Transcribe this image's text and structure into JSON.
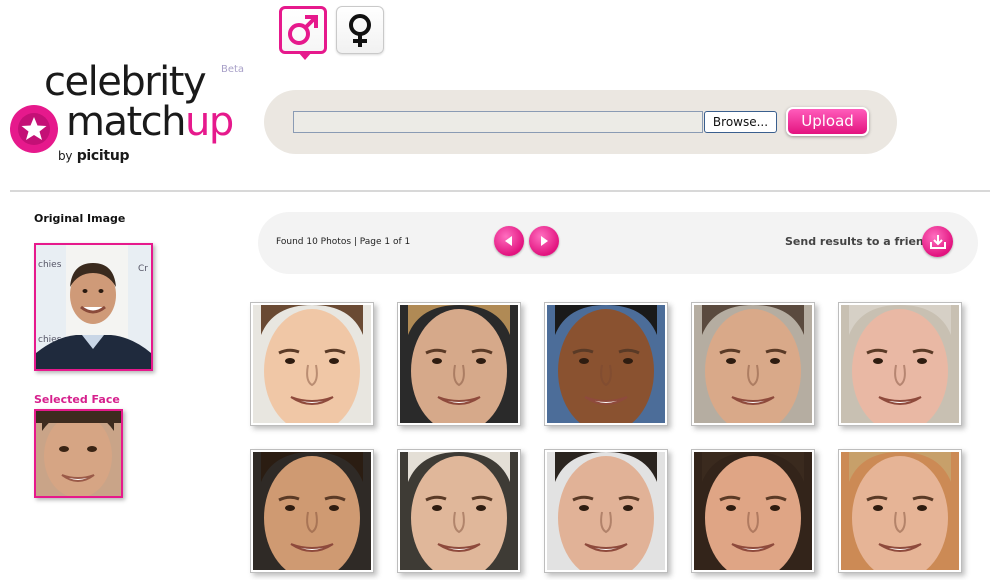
{
  "header": {
    "gender_selector": [
      {
        "id": "male",
        "icon": "male-symbol-icon",
        "selected": true
      },
      {
        "id": "female",
        "icon": "female-symbol-icon",
        "selected": false
      }
    ]
  },
  "logo": {
    "line1": "celebrity",
    "line2_part1": "match",
    "line2_part2": "up",
    "by_prefix": "by",
    "byline": "picitup",
    "badge": "Beta",
    "icon": "star-icon"
  },
  "upload": {
    "browse_label": "Browse...",
    "upload_label": "Upload"
  },
  "left_panel": {
    "original_label": "Original Image",
    "selected_label": "Selected Face"
  },
  "results": {
    "summary": "Found 10 Photos | Page 1 of 1",
    "send_label": "Send results to a friend",
    "prev_icon": "arrow-left-icon",
    "next_icon": "arrow-right-icon",
    "send_icon": "inbox-download-icon"
  },
  "colors": {
    "accent": "#e6198c",
    "bar_background": "#ebe7e1",
    "results_bar": "#f3f3f3",
    "selected_label": "#d6208d"
  },
  "photos": [
    {
      "skin": "#f0c7a6",
      "bg": "#e8e6e0",
      "hair": "#6a4a33"
    },
    {
      "skin": "#d6a98a",
      "bg": "#2a2a2a",
      "hair": "#b08a55"
    },
    {
      "skin": "#8a5230",
      "bg": "#4c6d99",
      "hair": "#1a1a1a"
    },
    {
      "skin": "#d9a989",
      "bg": "#b5ada1",
      "hair": "#5a4a3e"
    },
    {
      "skin": "#e9b8a4",
      "bg": "#c8c0b2",
      "hair": "#d6d0c6"
    },
    {
      "skin": "#cf9a72",
      "bg": "#2f2a26",
      "hair": "#2b1d12"
    },
    {
      "skin": "#e0b79a",
      "bg": "#3e3b35",
      "hair": "#e4dfd6"
    },
    {
      "skin": "#e1b297",
      "bg": "#e2e2e2",
      "hair": "#2a241f"
    },
    {
      "skin": "#dfa585",
      "bg": "#33241a",
      "hair": "#3a2a1e"
    },
    {
      "skin": "#e6b496",
      "bg": "#cc8a55",
      "hair": "#c7a06a"
    }
  ]
}
